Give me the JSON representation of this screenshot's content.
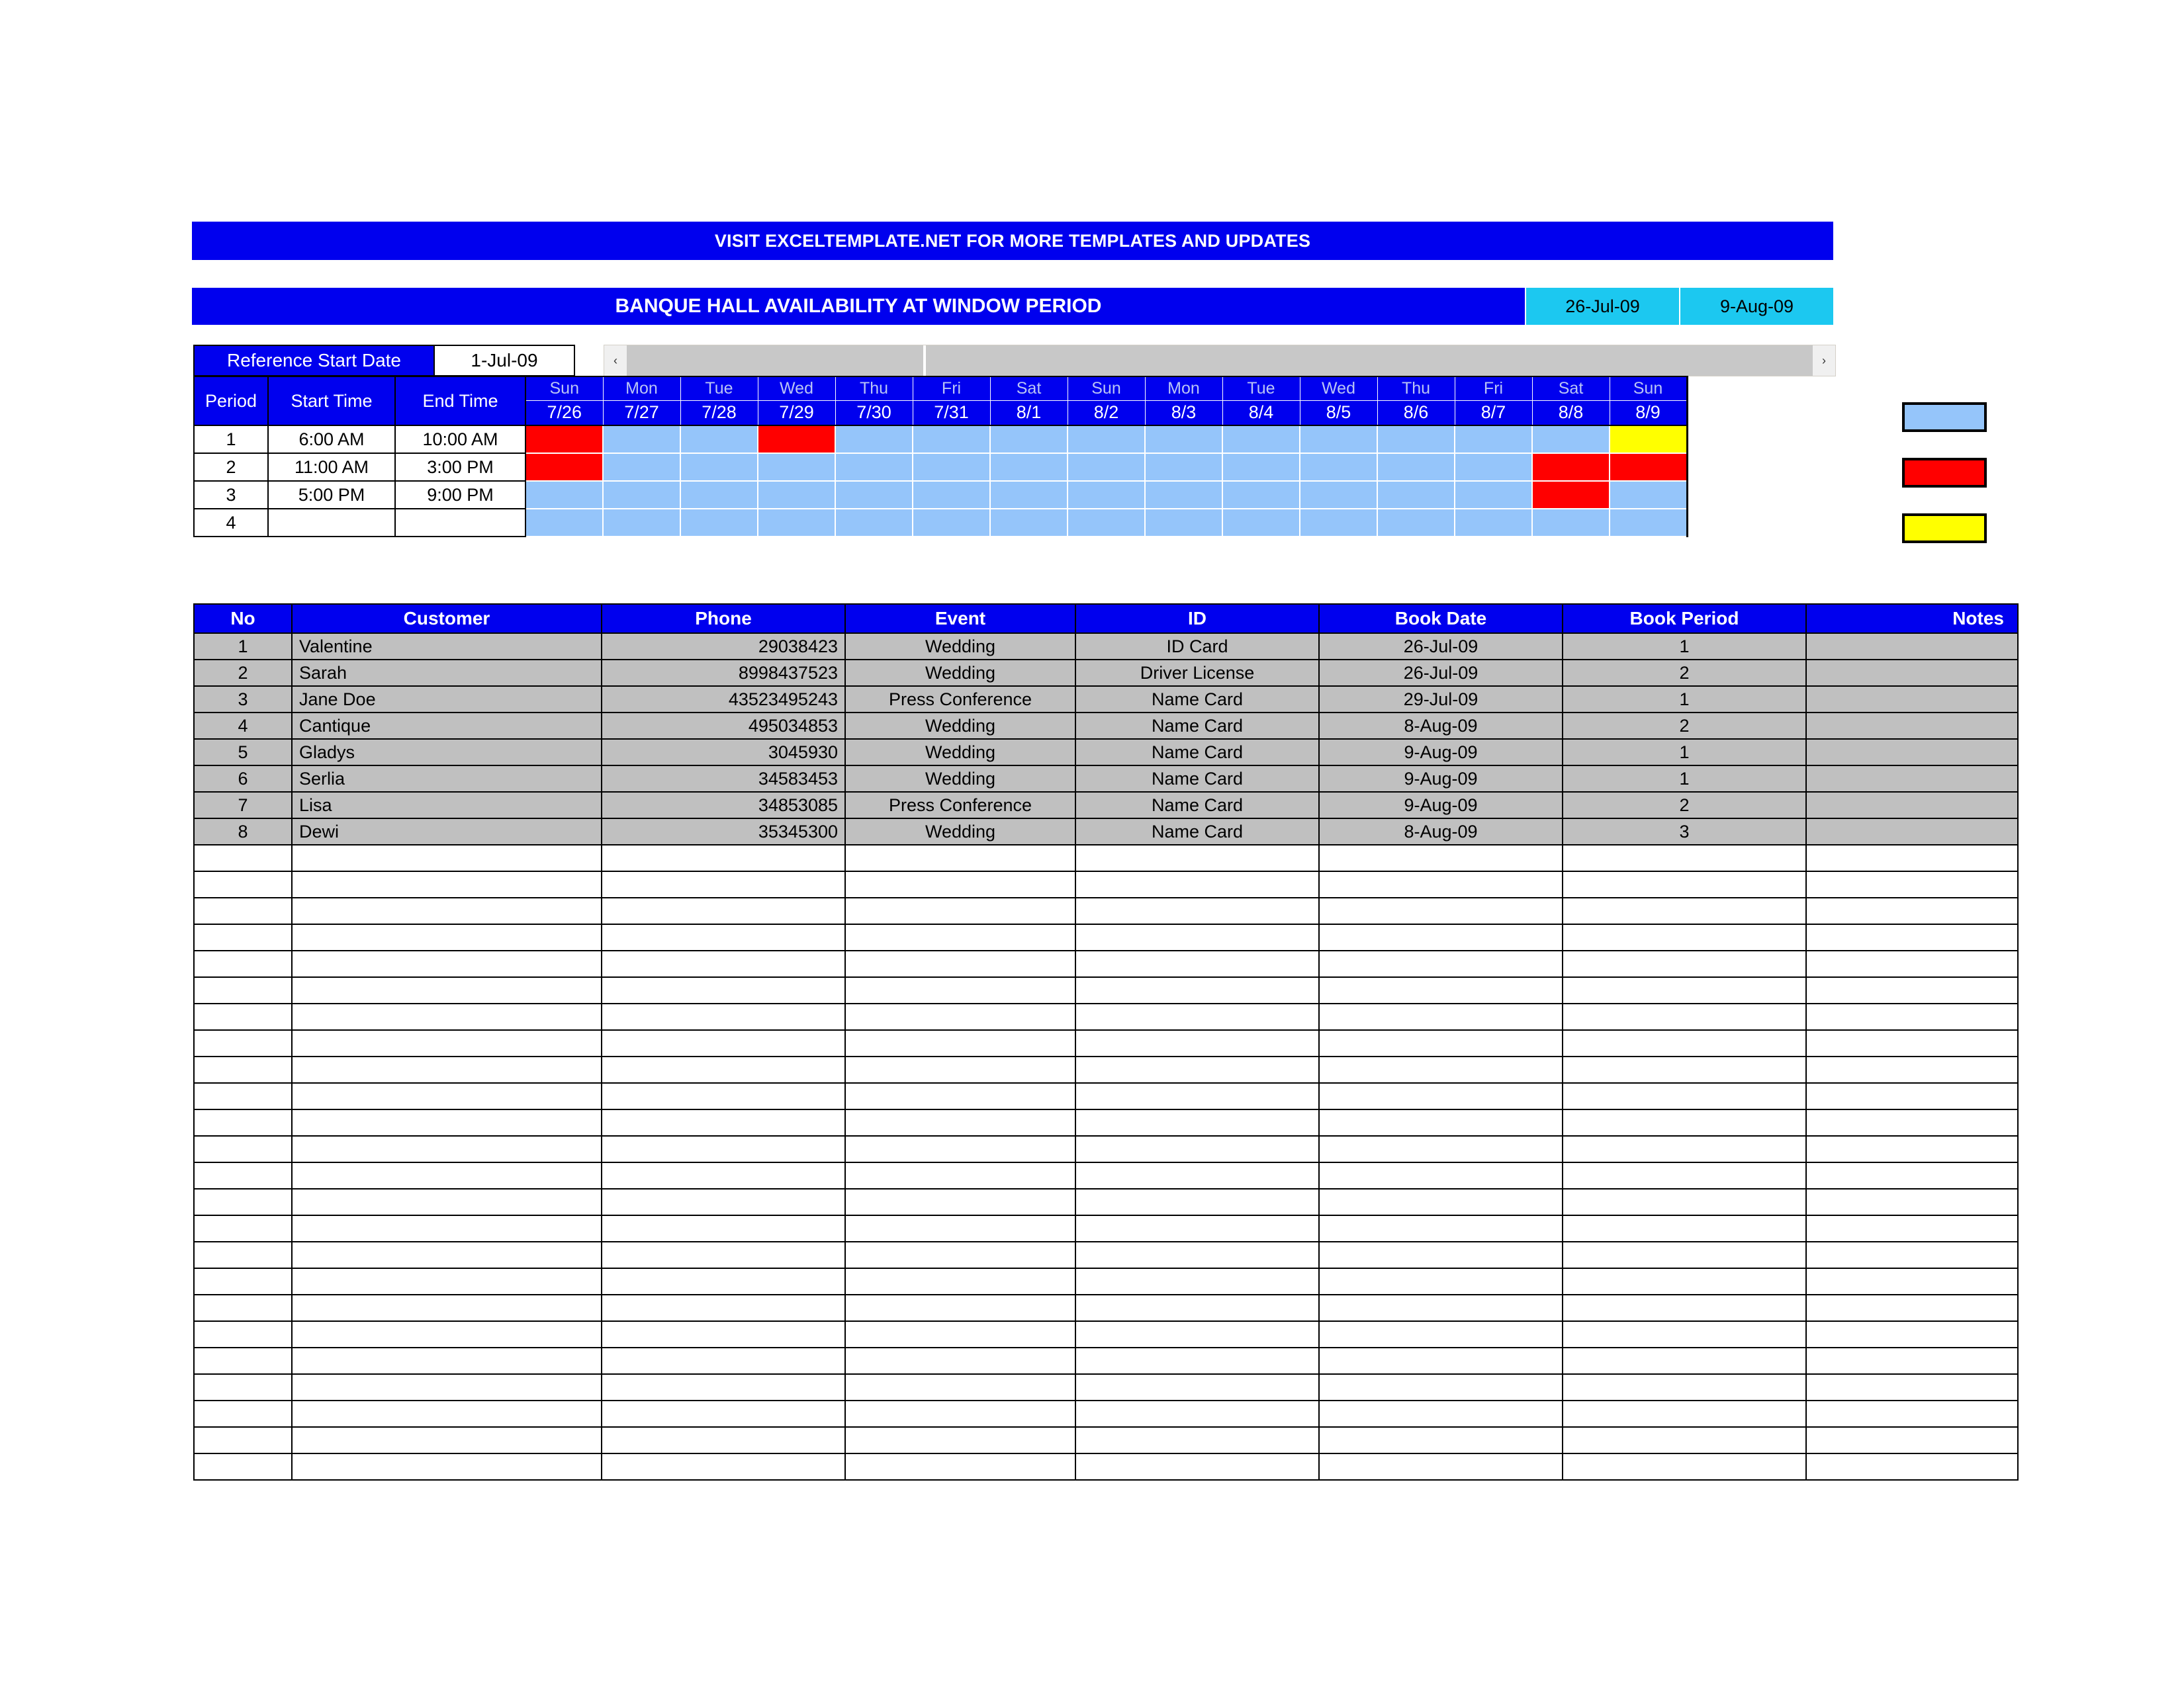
{
  "promo_banner": {
    "text": "VISIT EXCELTEMPLATE.NET FOR MORE TEMPLATES AND UPDATES"
  },
  "title_row": {
    "title": "BANQUE HALL AVAILABILITY AT WINDOW PERIOD",
    "window_start": "26-Jul-09",
    "window_end": "9-Aug-09"
  },
  "reference": {
    "label": "Reference Start Date",
    "value": "1-Jul-09"
  },
  "scrollbar": {
    "left_arrow": "‹",
    "right_arrow": "›"
  },
  "availability": {
    "headers": {
      "period": "Period",
      "start_time": "Start Time",
      "end_time": "End Time"
    },
    "days": [
      {
        "name": "Sun",
        "date": "7/26"
      },
      {
        "name": "Mon",
        "date": "7/27"
      },
      {
        "name": "Tue",
        "date": "7/28"
      },
      {
        "name": "Wed",
        "date": "7/29"
      },
      {
        "name": "Thu",
        "date": "7/30"
      },
      {
        "name": "Fri",
        "date": "7/31"
      },
      {
        "name": "Sat",
        "date": "8/1"
      },
      {
        "name": "Sun",
        "date": "8/2"
      },
      {
        "name": "Mon",
        "date": "8/3"
      },
      {
        "name": "Tue",
        "date": "8/4"
      },
      {
        "name": "Wed",
        "date": "8/5"
      },
      {
        "name": "Thu",
        "date": "8/6"
      },
      {
        "name": "Fri",
        "date": "8/7"
      },
      {
        "name": "Sat",
        "date": "8/8"
      },
      {
        "name": "Sun",
        "date": "8/9"
      }
    ],
    "rows": [
      {
        "period": "1",
        "start_time": "6:00 AM",
        "end_time": "10:00 AM",
        "slots": [
          "booked",
          "free",
          "free",
          "booked",
          "free",
          "free",
          "free",
          "free",
          "free",
          "free",
          "free",
          "free",
          "free",
          "free",
          "pending"
        ]
      },
      {
        "period": "2",
        "start_time": "11:00 AM",
        "end_time": "3:00 PM",
        "slots": [
          "booked",
          "free",
          "free",
          "free",
          "free",
          "free",
          "free",
          "free",
          "free",
          "free",
          "free",
          "free",
          "free",
          "booked",
          "booked"
        ]
      },
      {
        "period": "3",
        "start_time": "5:00 PM",
        "end_time": "9:00 PM",
        "slots": [
          "free",
          "free",
          "free",
          "free",
          "free",
          "free",
          "free",
          "free",
          "free",
          "free",
          "free",
          "free",
          "free",
          "booked",
          "free"
        ]
      },
      {
        "period": "4",
        "start_time": "",
        "end_time": "",
        "slots": [
          "free",
          "free",
          "free",
          "free",
          "free",
          "free",
          "free",
          "free",
          "free",
          "free",
          "free",
          "free",
          "free",
          "free",
          "free"
        ]
      }
    ]
  },
  "legend": {
    "colors": {
      "free": "#95C5FA",
      "booked": "#FF0000",
      "pending": "#FFFF00"
    },
    "swatches": [
      "free",
      "booked",
      "pending"
    ]
  },
  "booking_table": {
    "columns": [
      "No",
      "Customer",
      "Phone",
      "Event",
      "ID",
      "Book Date",
      "Book Period",
      "Notes"
    ],
    "rows": [
      {
        "no": "1",
        "customer": "Valentine",
        "phone": "29038423",
        "event": "Wedding",
        "id": "ID Card",
        "book_date": "26-Jul-09",
        "book_period": "1",
        "notes": ""
      },
      {
        "no": "2",
        "customer": "Sarah",
        "phone": "8998437523",
        "event": "Wedding",
        "id": "Driver License",
        "book_date": "26-Jul-09",
        "book_period": "2",
        "notes": ""
      },
      {
        "no": "3",
        "customer": "Jane Doe",
        "phone": "43523495243",
        "event": "Press Conference",
        "id": "Name Card",
        "book_date": "29-Jul-09",
        "book_period": "1",
        "notes": ""
      },
      {
        "no": "4",
        "customer": "Cantique",
        "phone": "495034853",
        "event": "Wedding",
        "id": "Name Card",
        "book_date": "8-Aug-09",
        "book_period": "2",
        "notes": ""
      },
      {
        "no": "5",
        "customer": "Gladys",
        "phone": "3045930",
        "event": "Wedding",
        "id": "Name Card",
        "book_date": "9-Aug-09",
        "book_period": "1",
        "notes": ""
      },
      {
        "no": "6",
        "customer": "Serlia",
        "phone": "34583453",
        "event": "Wedding",
        "id": "Name Card",
        "book_date": "9-Aug-09",
        "book_period": "1",
        "notes": ""
      },
      {
        "no": "7",
        "customer": "Lisa",
        "phone": "34853085",
        "event": "Press Conference",
        "id": "Name Card",
        "book_date": "9-Aug-09",
        "book_period": "2",
        "notes": ""
      },
      {
        "no": "8",
        "customer": "Dewi",
        "phone": "35345300",
        "event": "Wedding",
        "id": "Name Card",
        "book_date": "8-Aug-09",
        "book_period": "3",
        "notes": ""
      }
    ],
    "empty_row_count": 24
  }
}
